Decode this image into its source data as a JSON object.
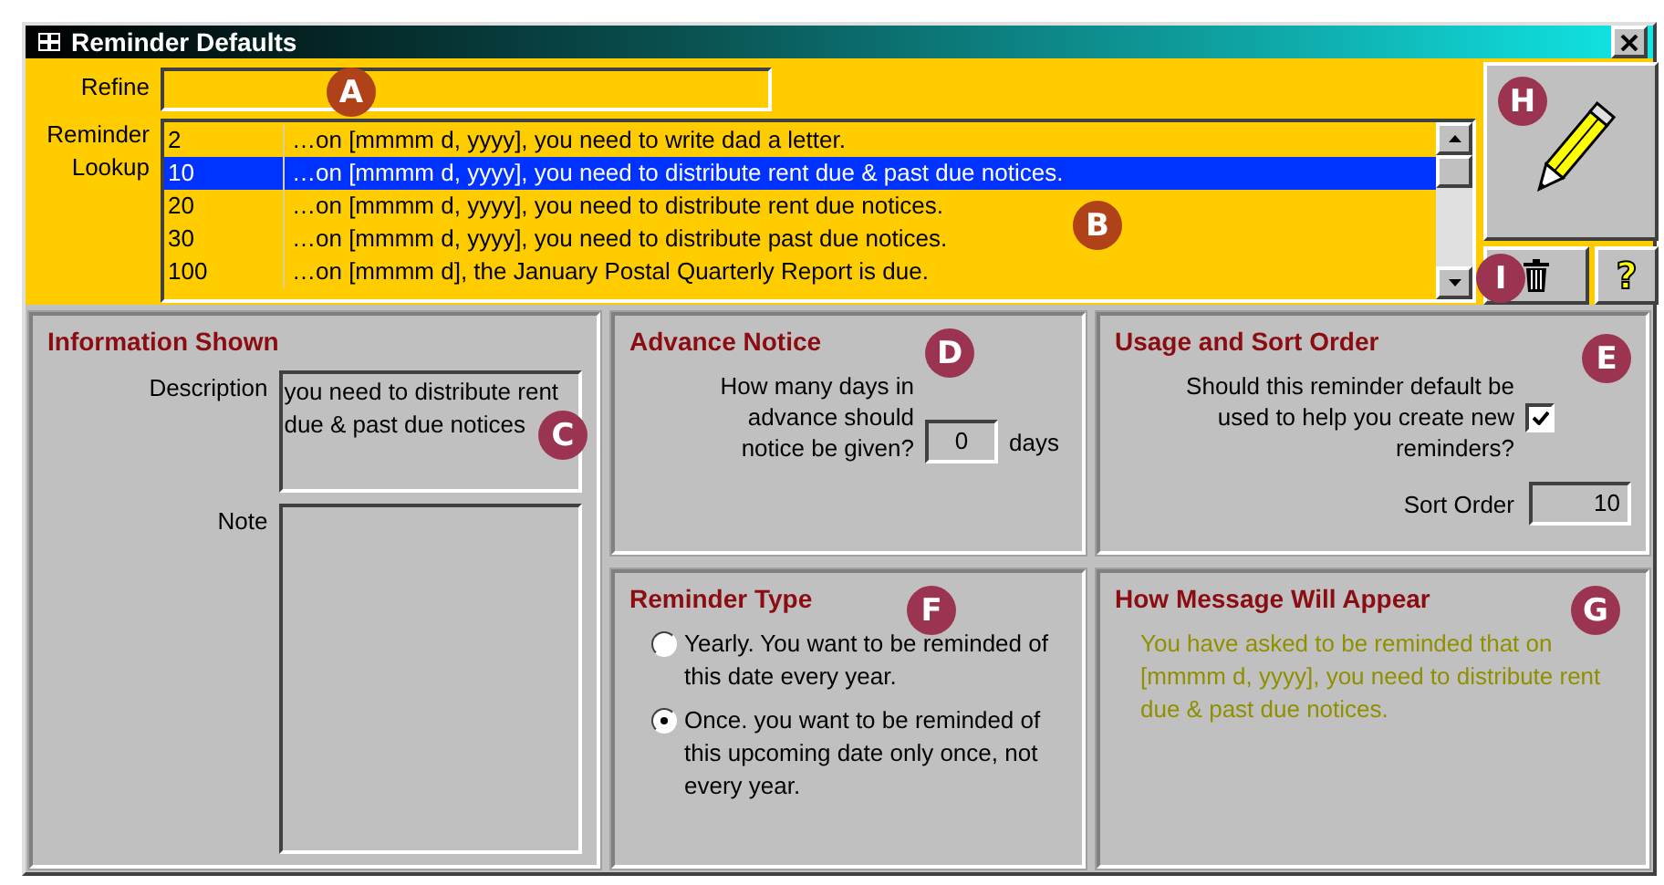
{
  "window": {
    "title": "Reminder Defaults"
  },
  "refine": {
    "label": "Refine",
    "callout": "A"
  },
  "lookup": {
    "label": "Reminder Lookup",
    "callout": "B",
    "rows": [
      {
        "order": "2",
        "message": "…on [mmmm d, yyyy], you need to write dad a letter.",
        "selected": false
      },
      {
        "order": "10",
        "message": "…on [mmmm d, yyyy], you need to distribute rent due & past due notices.",
        "selected": true
      },
      {
        "order": "20",
        "message": "…on [mmmm d, yyyy], you need to distribute rent due notices.",
        "selected": false
      },
      {
        "order": "30",
        "message": "…on [mmmm d, yyyy], you need to distribute past due notices.",
        "selected": false
      },
      {
        "order": "100",
        "message": "…on [mmmm d], the January Postal Quarterly Report is due.",
        "selected": false
      }
    ]
  },
  "edit_button": {
    "callout": "H"
  },
  "delete_button": {
    "callout": "I"
  },
  "help_button": {
    "label": "?"
  },
  "information": {
    "title": "Information Shown",
    "description_label": "Description",
    "description": "you need to distribute rent due & past due notices",
    "note_label": "Note",
    "callout": "C"
  },
  "advance_notice": {
    "title": "Advance Notice",
    "question": "How many days in advance should notice be given?",
    "value": "0",
    "unit": "days",
    "callout": "D"
  },
  "usage": {
    "title": "Usage and Sort Order",
    "question": "Should this reminder default be used to help you create new reminders?",
    "checked": true,
    "sort_label": "Sort Order",
    "sort_value": "10",
    "callout": "E"
  },
  "reminder_type": {
    "title": "Reminder Type",
    "callout": "F",
    "options": [
      {
        "label": "Yearly. You want to be reminded of this date every year.",
        "selected": false
      },
      {
        "label": "Once. you want to be reminded of this upcoming date only once, not every year.",
        "selected": true
      }
    ]
  },
  "message": {
    "title": "How Message Will Appear",
    "text": "You have asked to be reminded that on [mmmm d, yyyy], you need to distribute rent due & past due notices.",
    "callout": "G"
  }
}
